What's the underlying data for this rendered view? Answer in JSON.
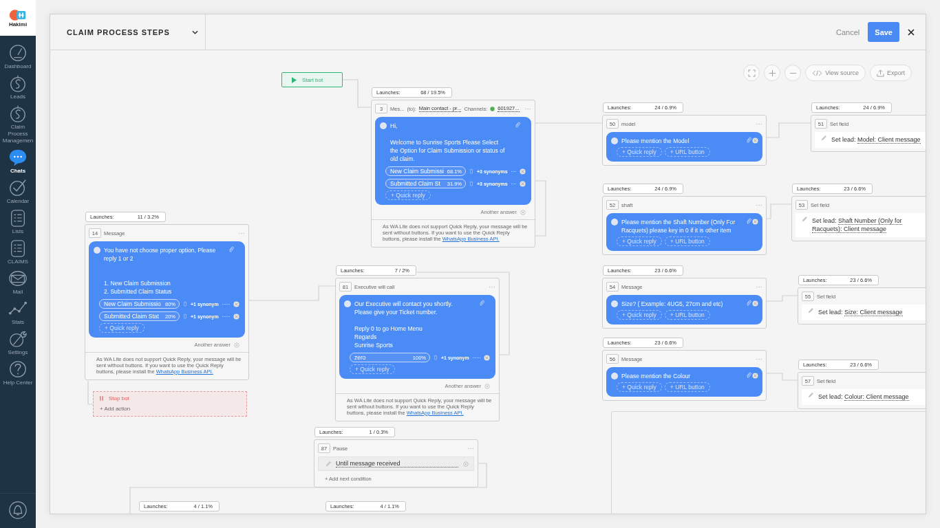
{
  "logo": {
    "name": "Hakimi"
  },
  "sidebar": {
    "items": [
      {
        "label": "Dashboard",
        "kind": "gauge",
        "selected": false
      },
      {
        "label": "Leads",
        "kind": "dollar",
        "selected": false
      },
      {
        "label": "Claim Process Managemen",
        "kind": "dollar",
        "selected": false
      },
      {
        "label": "Chats",
        "kind": "chat",
        "selected": true
      },
      {
        "label": "Calendar",
        "kind": "check",
        "selected": false
      },
      {
        "label": "Lists",
        "kind": "list",
        "selected": false
      },
      {
        "label": "CLAIMS",
        "kind": "list",
        "selected": false
      },
      {
        "label": "Mail",
        "kind": "mail",
        "selected": false
      },
      {
        "label": "Stats",
        "kind": "stats",
        "selected": false
      },
      {
        "label": "Settings",
        "kind": "wrench",
        "selected": false
      },
      {
        "label": "Help Center",
        "kind": "help",
        "selected": false
      }
    ]
  },
  "window": {
    "title": "CLAIM PROCESS STEPS",
    "cancel": "Cancel",
    "save": "Save"
  },
  "canvas_toolbar": {
    "view_source": "View source",
    "export": "Export"
  },
  "nodes": [
    {
      "kind": "start",
      "label": "Start bot"
    },
    {
      "kind": "message",
      "launches_label": "Launches:",
      "launches": "68 / 19.5%",
      "number": "3",
      "title": "Mes...",
      "to_label": "(to):",
      "to_value": "Main contact - pr...",
      "channels_label": "Channels:",
      "channel": "601927...",
      "text": "Hi,\n\nWelcome to Sunrise Sports Please Select the Option for Claim Submission or status of old claim.",
      "buttons": [
        {
          "label": "New Claim Submissi",
          "percent": "68.1%",
          "synonyms": "+3 synonyms"
        },
        {
          "label": "Submitted Claim St",
          "percent": "31.9%",
          "synonyms": "+3 synonyms"
        }
      ],
      "quick_reply": "+ Quick reply",
      "another_answer": "Another answer",
      "warning": "As WA Lite does not support Quick Reply, your message will be sent without buttons. If you want to use the Quick Reply buttons, please install the ",
      "link": "WhatsApp Business API."
    },
    {
      "kind": "message",
      "launches_label": "Launches:",
      "launches": "11 / 3.2%",
      "number": "14",
      "title": "Message",
      "text": "You have not choose proper option, Please reply 1 or 2\n\n\n1. New Claim Submission\n2. Submitted Claim Status",
      "buttons": [
        {
          "label": "New Claim Submissio",
          "percent": "80%",
          "synonyms": "+1 synonym"
        },
        {
          "label": "Submitted Claim Stat",
          "percent": "20%",
          "synonyms": "+1 synonym"
        }
      ],
      "quick_reply": "+ Quick reply",
      "another_answer": "Another answer",
      "warning": "As WA Lite does not support Quick Reply, your message will be sent without buttons. If you want to use the Quick Reply buttons, please install the ",
      "link": "WhatsApp Business API."
    },
    {
      "kind": "stop",
      "label": "Stop bot",
      "add": "+ Add action"
    },
    {
      "kind": "message",
      "launches_label": "Launches:",
      "launches": "7 / 2%",
      "number": "81",
      "title": "Executive will call",
      "text": "Our Executive will contact you shortly. Please give your Ticket number.\n\nReply 0 to go Home Menu\nRegards\nSunrise Sports",
      "buttons": [
        {
          "label": "zero",
          "percent": "100%",
          "synonyms": "+1 synonym"
        }
      ],
      "quick_reply": "+ Quick reply",
      "another_answer": "Another answer",
      "warning": "As WA Lite does not support Quick Reply, your message will be sent without buttons. If you want to use the Quick Reply buttons, please install the ",
      "link": "WhatsApp Business API."
    },
    {
      "kind": "pause",
      "launches_label": "Launches:",
      "launches": "1 / 0.3%",
      "number": "87",
      "title": "Pause",
      "condition": "Until message received",
      "add": "+ Add next condition"
    },
    {
      "kind": "message",
      "launches_label": "Launches:",
      "launches": "24 / 6.9%",
      "number": "50",
      "title": "model",
      "text": "Please mention the Model",
      "quick_reply": "+ Quick reply",
      "url_button": "+ URL button"
    },
    {
      "kind": "set_field",
      "launches_label": "Launches:",
      "launches": "24 / 6.9%",
      "number": "51",
      "title": "Set field",
      "action": "Set lead:",
      "value": "Model: Client message"
    },
    {
      "kind": "message",
      "launches_label": "Launches:",
      "launches": "24 / 6.9%",
      "number": "52",
      "title": "shaft",
      "text": "Please mention the Shaft Number (Only For Racquets) please key in 0 if it is other item",
      "quick_reply": "+ Quick reply",
      "url_button": "+ URL button"
    },
    {
      "kind": "set_field",
      "launches_label": "Launches:",
      "launches": "23 / 6.6%",
      "number": "53",
      "title": "Set field",
      "action": "Set lead:",
      "value": "Shaft Number (Only for Racquets): Client message"
    },
    {
      "kind": "message",
      "launches_label": "Launches:",
      "launches": "23 / 6.6%",
      "number": "54",
      "title": "Message",
      "text": "Size?  ( Example: 4UG5, 27cm and etc)",
      "quick_reply": "+ Quick reply",
      "url_button": "+ URL button"
    },
    {
      "kind": "set_field",
      "launches_label": "Launches:",
      "launches": "23 / 6.6%",
      "number": "55",
      "title": "Set field",
      "action": "Set lead:",
      "value": "Size: Client message"
    },
    {
      "kind": "message",
      "launches_label": "Launches:",
      "launches": "23 / 6.6%",
      "number": "56",
      "title": "Message",
      "text": "Please mention the Colour",
      "quick_reply": "+ Quick reply",
      "url_button": "+ URL button"
    },
    {
      "kind": "set_field",
      "launches_label": "Launches:",
      "launches": "23 / 6.6%",
      "number": "57",
      "title": "Set field",
      "action": "Set lead:",
      "value": "Colour: Client message"
    },
    {
      "kind": "stub",
      "launches_label": "Launches:",
      "launches": "4 / 1.1%"
    },
    {
      "kind": "stub",
      "launches_label": "Launches:",
      "launches": "4 / 1.1%"
    }
  ]
}
